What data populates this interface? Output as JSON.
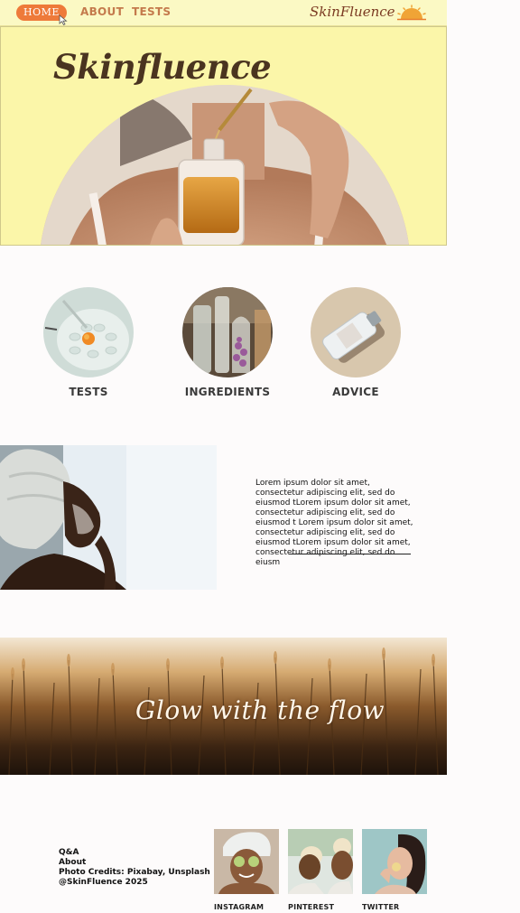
{
  "nav": {
    "home_label": "HOME",
    "about_label": "ABOUT",
    "tests_label": "TESTS",
    "logo_text": "SkinFluence"
  },
  "hero": {
    "title": "Skinfluence"
  },
  "categories": [
    {
      "label": "TESTS"
    },
    {
      "label": "INGREDIENTS"
    },
    {
      "label": "ADVICE"
    }
  ],
  "article": {
    "text": "Lorem ipsum dolor sit amet, consectetur adipiscing elit, sed do eiusmod tLorem ipsum dolor sit amet, consectetur adipiscing elit, sed do eiusmod t Lorem ipsum dolor sit amet, consectetur adipiscing elit, sed do eiusmod tLorem ipsum dolor sit amet, consectetur adipiscing elit, sed do eiusm"
  },
  "banner": {
    "text": "Glow with the flow"
  },
  "footer": {
    "links": [
      "Q&A",
      "About",
      "Photo Credits: Pixabay, Unsplash",
      "@SkinFluence 2025"
    ],
    "social": [
      {
        "label": "INSTAGRAM"
      },
      {
        "label": "PINTEREST"
      },
      {
        "label": "TWITTER"
      }
    ]
  },
  "colors": {
    "nav_bg": "#fbf9c4",
    "hero_bg": "#fbf6a9",
    "accent_orange": "#ee7a3a",
    "nav_link": "#c47a4c",
    "title_brown": "#4a3420"
  }
}
